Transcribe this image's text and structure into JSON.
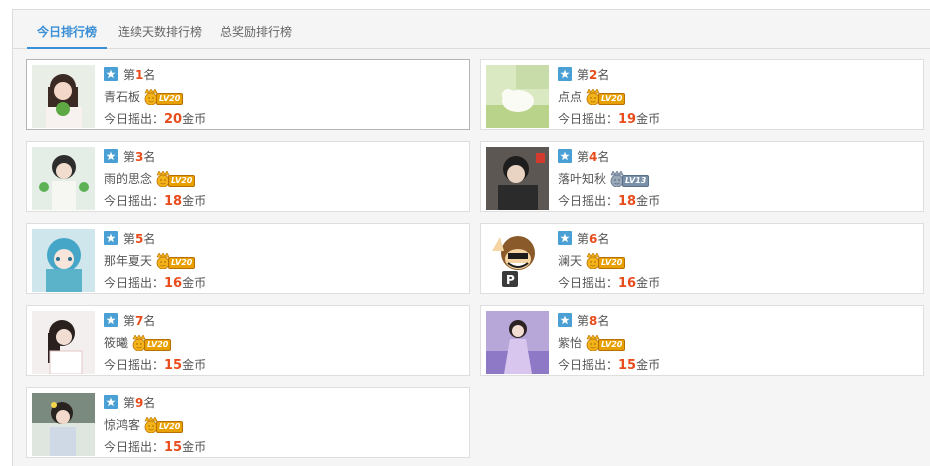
{
  "tabs": [
    {
      "label": "今日排行榜",
      "active": true
    },
    {
      "label": "连续天数排行榜",
      "active": false
    },
    {
      "label": "总奖励排行榜",
      "active": false
    }
  ],
  "rank_prefix": "第",
  "rank_suffix": "名",
  "amount_prefix": "今日摇出：",
  "amount_suffix": "金币",
  "colors": {
    "accent": "#3a8fd6",
    "highlight": "#e84c1c",
    "badge": "#4a9fd4"
  },
  "entries": [
    {
      "rank": "1",
      "name": "青石板",
      "level": "LV20",
      "amount": "20"
    },
    {
      "rank": "2",
      "name": "点点",
      "level": "LV20",
      "amount": "19"
    },
    {
      "rank": "3",
      "name": "雨的思念",
      "level": "LV20",
      "amount": "18"
    },
    {
      "rank": "4",
      "name": "落叶知秋",
      "level": "LV13",
      "amount": "18"
    },
    {
      "rank": "5",
      "name": "那年夏天",
      "level": "LV20",
      "amount": "16"
    },
    {
      "rank": "6",
      "name": "澜天",
      "level": "LV20",
      "amount": "16"
    },
    {
      "rank": "7",
      "name": "筱曦",
      "level": "LV20",
      "amount": "15"
    },
    {
      "rank": "8",
      "name": "紫怡",
      "level": "LV20",
      "amount": "15"
    },
    {
      "rank": "9",
      "name": "惊鸿客",
      "level": "LV20",
      "amount": "15"
    }
  ]
}
